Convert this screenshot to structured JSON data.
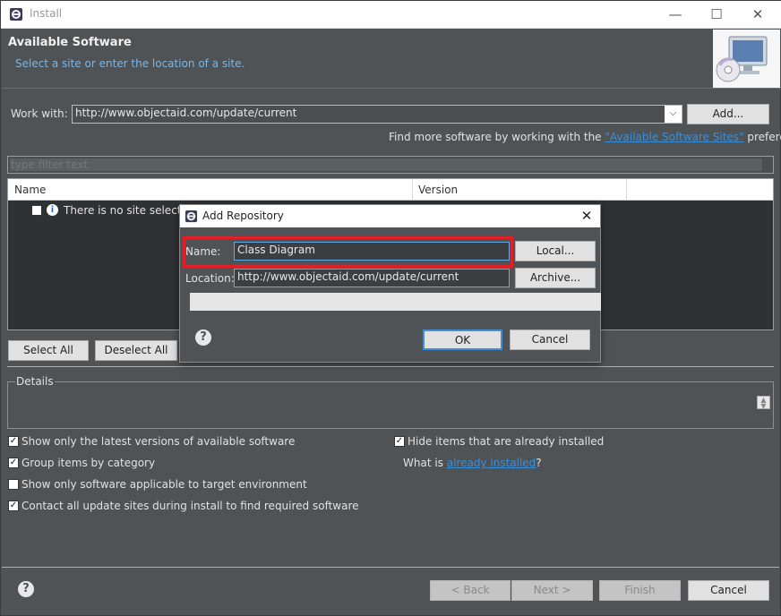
{
  "window": {
    "title": "Install",
    "controls": [
      "minimize",
      "maximize",
      "close"
    ]
  },
  "header": {
    "title": "Available Software",
    "description": "Select a site or enter the location of a site."
  },
  "work_with": {
    "label": "Work with:",
    "value": "http://www.objectaid.com/update/current",
    "add_label": "Add...",
    "more_prefix": "Find more software by working with the ",
    "more_link": "\"Available Software Sites\"",
    "more_suffix": " preferences."
  },
  "filter": {
    "placeholder": "type filter text"
  },
  "tree": {
    "columns": [
      "Name",
      "Version"
    ],
    "rows": [
      {
        "text": "There is no site selected.",
        "checked": false
      }
    ]
  },
  "selection_buttons": {
    "select_all": "Select All",
    "deselect_all": "Deselect All"
  },
  "details": {
    "label": "Details"
  },
  "options": {
    "latest_versions": {
      "label": "Show only the latest versions of available software",
      "checked": true
    },
    "group_by_category": {
      "label": "Group items by category",
      "checked": true
    },
    "target_env": {
      "label": "Show only software applicable to target environment",
      "checked": false
    },
    "contact_sites": {
      "label": "Contact all update sites during install to find required software",
      "checked": true
    },
    "hide_installed": {
      "label": "Hide items that are already installed",
      "checked": true
    },
    "what_is_prefix": "What is ",
    "what_is_link": "already installed",
    "what_is_suffix": "?"
  },
  "footer": {
    "back": "< Back",
    "next": "Next >",
    "finish": "Finish",
    "cancel": "Cancel"
  },
  "dialog": {
    "title": "Add Repository",
    "name_label": "Name:",
    "name_value": "Class Diagram",
    "location_label": "Location:",
    "location_value": "http://www.objectaid.com/update/current",
    "local_button": "Local...",
    "archive_button": "Archive...",
    "ok": "OK",
    "cancel": "Cancel",
    "highlight_color": "#e21e26"
  },
  "colors": {
    "background": "#4f5355",
    "link": "#3b8ed8",
    "header_description": "#7fb5e0"
  }
}
